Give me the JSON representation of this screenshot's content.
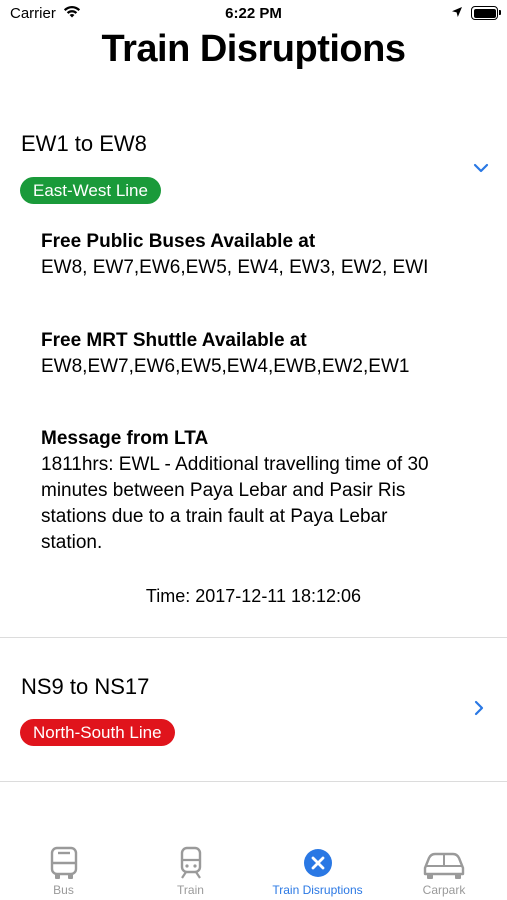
{
  "status_bar": {
    "carrier": "Carrier",
    "time": "6:22 PM"
  },
  "page": {
    "title": "Train Disruptions"
  },
  "disruptions": [
    {
      "title": "EW1 to EW8",
      "line": "East-West Line",
      "line_color": "#1a9a3a",
      "expanded": true,
      "bus_heading": "Free Public Buses Available at",
      "bus_stations": "EW8, EW7,EW6,EW5, EW4, EW3, EW2, EWI",
      "shuttle_heading": "Free MRT Shuttle Available at",
      "shuttle_stations": "EW8,EW7,EW6,EW5,EW4,EWB,EW2,EW1",
      "message_heading": "Message from LTA",
      "message_lines": [
        "1811hrs: EWL - Additional travelling time of 30",
        "minutes between Paya Lebar and Pasir Ris",
        "stations due to a train fault at Paya Lebar",
        "station."
      ],
      "time": "Time: 2017-12-11 18:12:06"
    },
    {
      "title": "NS9 to NS17",
      "line": "North-South Line",
      "line_color": "#e0141c",
      "expanded": false
    }
  ],
  "tabs": [
    {
      "label": "Bus",
      "icon": "bus-icon",
      "active": false
    },
    {
      "label": "Train",
      "icon": "train-icon",
      "active": false
    },
    {
      "label": "Train Disruptions",
      "icon": "close-circle-icon",
      "active": true
    },
    {
      "label": "Carpark",
      "icon": "car-icon",
      "active": false
    }
  ],
  "colors": {
    "accent": "#2a78e4",
    "inactive_tab": "#9a9a9a"
  }
}
